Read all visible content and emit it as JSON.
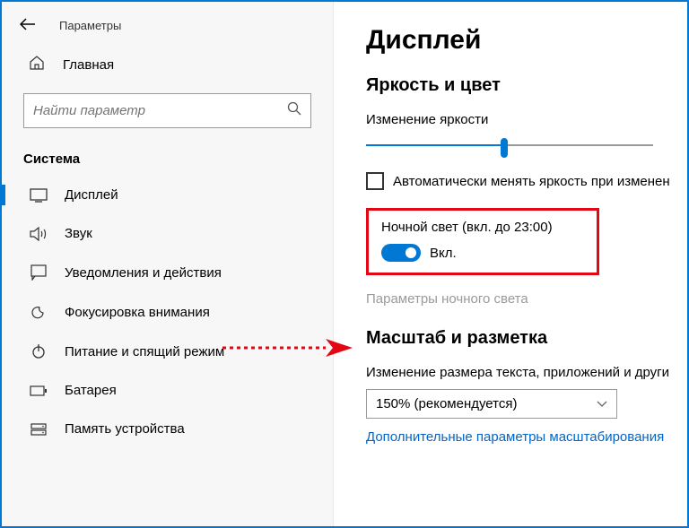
{
  "header": {
    "title": "Параметры"
  },
  "sidebar": {
    "home": "Главная",
    "search_placeholder": "Найти параметр",
    "category": "Система",
    "items": [
      {
        "label": "Дисплей"
      },
      {
        "label": "Звук"
      },
      {
        "label": "Уведомления и действия"
      },
      {
        "label": "Фокусировка внимания"
      },
      {
        "label": "Питание и спящий режим"
      },
      {
        "label": "Батарея"
      },
      {
        "label": "Память устройства"
      }
    ]
  },
  "main": {
    "title": "Дисплей",
    "brightness": {
      "section": "Яркость и цвет",
      "label": "Изменение яркости",
      "auto_checkbox": "Автоматически менять яркость при изменен"
    },
    "night": {
      "title": "Ночной свет (вкл. до 23:00)",
      "state": "Вкл.",
      "settings_link": "Параметры ночного света"
    },
    "scale": {
      "section": "Масштаб и разметка",
      "label": "Изменение размера текста, приложений и други",
      "dropdown_value": "150% (рекомендуется)",
      "advanced_link": "Дополнительные параметры масштабирования"
    }
  }
}
